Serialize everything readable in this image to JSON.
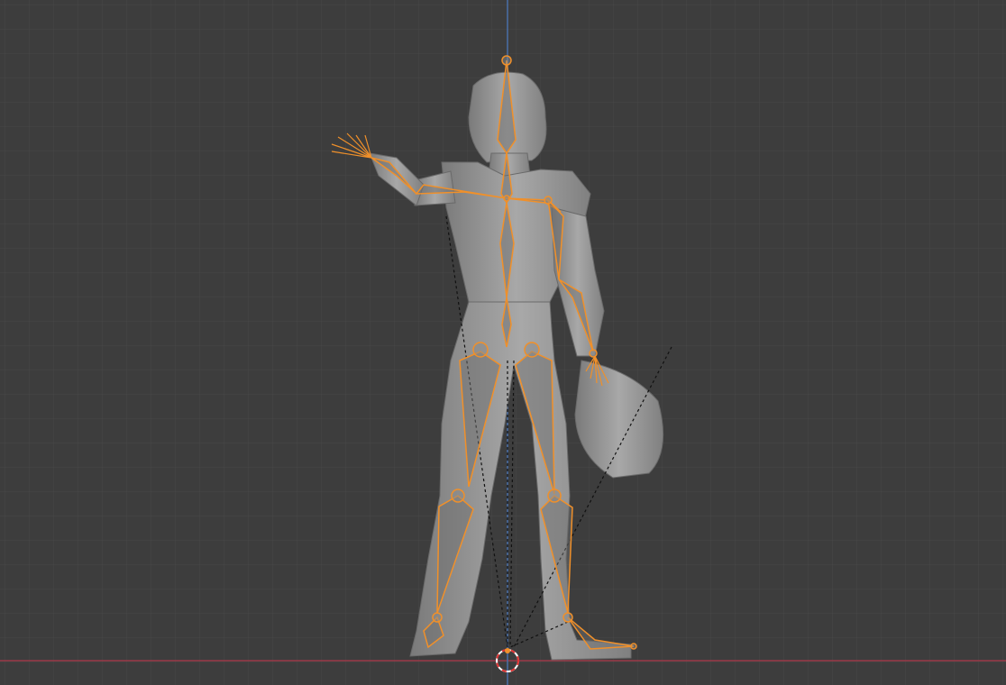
{
  "viewport": {
    "background_color": "#3d3d3d",
    "grid_color": "#484848",
    "x_axis_color": "#9b3a48",
    "z_axis_color": "#4a6fa8"
  },
  "model": {
    "mesh_color": "#9a9a9a",
    "armature_color": "#f0902a",
    "relationship_line_color": "#111111"
  },
  "cursor": {
    "icon": "3d-cursor-icon",
    "colors": [
      "#e03030",
      "#ffffff"
    ]
  }
}
